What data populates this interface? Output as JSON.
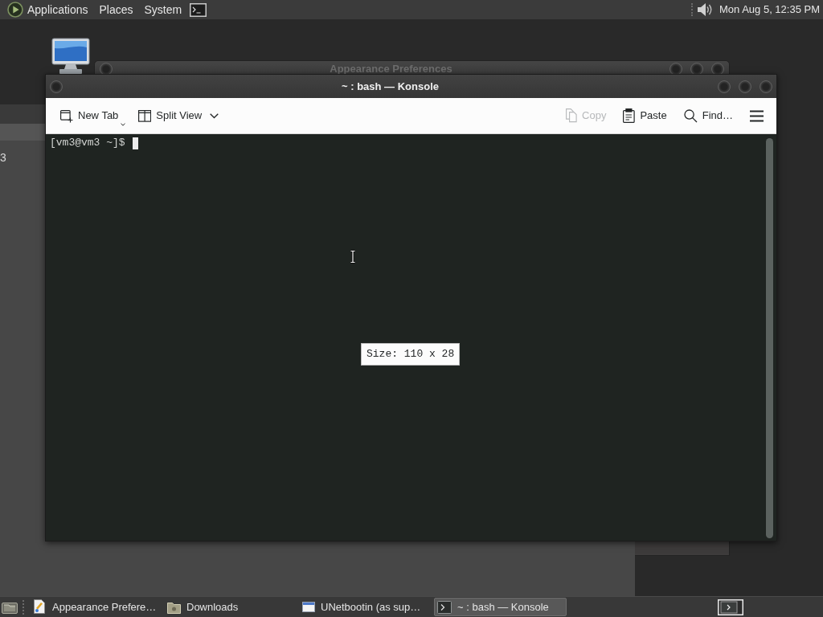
{
  "top_panel": {
    "menus": [
      "Applications",
      "Places",
      "System"
    ],
    "clock": "Mon Aug 5, 12:35 PM"
  },
  "background_window": {
    "text": "3"
  },
  "appearance_window": {
    "title": "Appearance Preferences"
  },
  "konsole": {
    "title": "~ : bash — Konsole",
    "toolbar": {
      "left": [
        {
          "kind": "new-tab",
          "label": "New Tab",
          "disabled": false
        },
        {
          "kind": "split-view",
          "label": "Split View",
          "disabled": false
        }
      ],
      "right": [
        {
          "kind": "copy",
          "label": "Copy",
          "disabled": true
        },
        {
          "kind": "paste",
          "label": "Paste",
          "disabled": false
        },
        {
          "kind": "find",
          "label": "Find…",
          "disabled": false
        },
        {
          "kind": "menu",
          "disabled": false
        }
      ]
    },
    "prompt": "[vm3@vm3 ~]$",
    "size_tooltip": "Size: 110 x 28"
  },
  "taskbar": {
    "tasks": [
      {
        "kind": "preferences",
        "label": "Appearance Prefere…",
        "selected": false
      },
      {
        "kind": "folder",
        "label": "Downloads",
        "selected": false
      },
      {
        "kind": "window",
        "label": "UNetbootin (as sup…",
        "selected": false
      },
      {
        "kind": "terminal",
        "label": "~ : bash — Konsole",
        "selected": true
      }
    ]
  }
}
